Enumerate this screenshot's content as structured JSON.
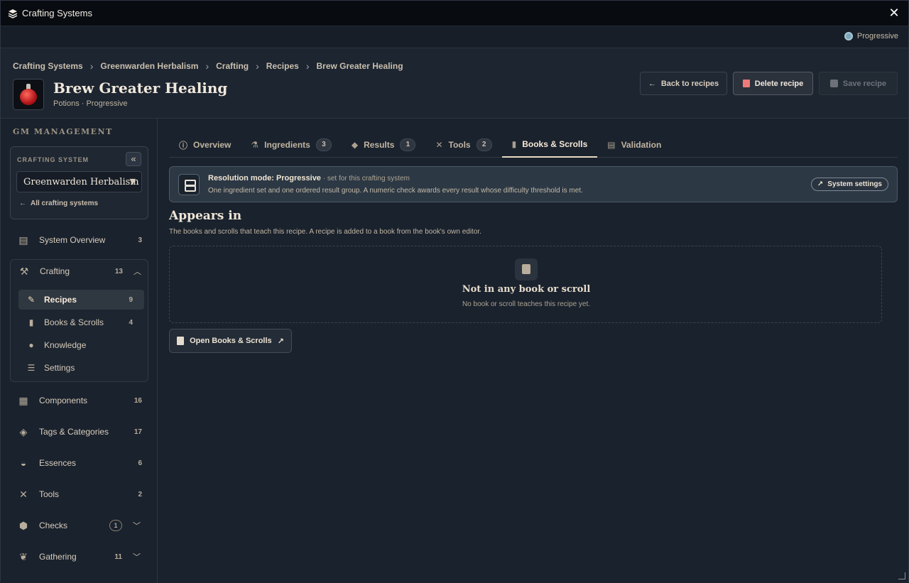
{
  "titlebar": {
    "title": "Crafting Systems"
  },
  "mode_strip": {
    "mode": "Progressive"
  },
  "breadcrumb": [
    "Crafting Systems",
    "Greenwarden Herbalism",
    "Crafting",
    "Recipes",
    "Brew Greater Healing"
  ],
  "recipe": {
    "title": "Brew Greater Healing",
    "subtitle": "Potions · Progressive"
  },
  "actions": {
    "back": "Back to recipes",
    "delete": "Delete recipe",
    "save": "Save recipe"
  },
  "sidebar": {
    "section": "GM MANAGEMENT",
    "system_label": "CRAFTING SYSTEM",
    "system_value": "Greenwarden Herbalism",
    "all_link": "All crafting systems",
    "overview": {
      "label": "System Overview",
      "count": "3"
    },
    "crafting": {
      "label": "Crafting",
      "count": "13"
    },
    "sub": [
      {
        "label": "Recipes",
        "count": "9"
      },
      {
        "label": "Books & Scrolls",
        "count": "4"
      },
      {
        "label": "Knowledge",
        "count": ""
      },
      {
        "label": "Settings",
        "count": ""
      }
    ],
    "items": [
      {
        "label": "Components",
        "count": "16"
      },
      {
        "label": "Tags & Categories",
        "count": "17"
      },
      {
        "label": "Essences",
        "count": "6"
      },
      {
        "label": "Tools",
        "count": "2"
      },
      {
        "label": "Checks",
        "badge": "1"
      },
      {
        "label": "Gathering",
        "count": "11"
      }
    ]
  },
  "tabs": [
    {
      "label": "Overview",
      "count": ""
    },
    {
      "label": "Ingredients",
      "count": "3"
    },
    {
      "label": "Results",
      "count": "1"
    },
    {
      "label": "Tools",
      "count": "2"
    },
    {
      "label": "Books & Scrolls",
      "count": ""
    },
    {
      "label": "Validation",
      "count": ""
    }
  ],
  "info": {
    "title": "Resolution mode: Progressive",
    "note": " · set for this crafting system",
    "description": "One ingredient set and one ordered result group. A numeric check awards every result whose difficulty threshold is met.",
    "button": "System settings"
  },
  "appears": {
    "title": "Appears in",
    "description": "The books and scrolls that teach this recipe. A recipe is added to a book from the book's own editor.",
    "empty_title": "Not in any book or scroll",
    "empty_desc": "No book or scroll teaches this recipe yet.",
    "open_button": "Open Books & Scrolls"
  },
  "colors": {
    "accent": "#e7d9c3",
    "danger": "#f07a7a",
    "panel": "#1a222d"
  }
}
